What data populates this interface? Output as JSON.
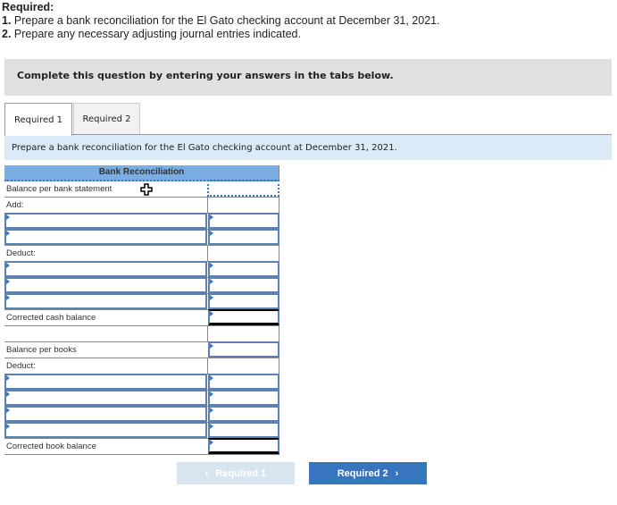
{
  "required": {
    "title": "Required:",
    "items": [
      {
        "num": "1.",
        "text": "Prepare a bank reconciliation for the El Gato checking account at December 31, 2021."
      },
      {
        "num": "2.",
        "text": "Prepare any necessary adjusting journal entries indicated."
      }
    ]
  },
  "instruction": "Complete this question by entering your answers in the tabs below.",
  "tabs": [
    {
      "label": "Required 1",
      "active": true
    },
    {
      "label": "Required 2",
      "active": false
    }
  ],
  "prompt": "Prepare a bank reconciliation for the El Gato checking account at December 31, 2021.",
  "reconciliation": {
    "title": "Bank Reconciliation",
    "rows": [
      {
        "label": "Balance per bank statement",
        "label_value": "",
        "amount_value": ""
      },
      {
        "label": "Add:"
      },
      {
        "label_value": "",
        "amount_value": ""
      },
      {
        "label_value": "",
        "amount_value": ""
      },
      {
        "label": "Deduct:"
      },
      {
        "label_value": "",
        "amount_value": ""
      },
      {
        "label_value": "",
        "amount_value": ""
      },
      {
        "label_value": "",
        "amount_value": ""
      },
      {
        "label": "Corrected cash balance",
        "amount_value": ""
      },
      {
        "label": ""
      },
      {
        "label": "Balance per books",
        "amount_value": ""
      },
      {
        "label": "Deduct:"
      },
      {
        "label_value": "",
        "amount_value": ""
      },
      {
        "label_value": "",
        "amount_value": ""
      },
      {
        "label_value": "",
        "amount_value": ""
      },
      {
        "label_value": "",
        "amount_value": ""
      },
      {
        "label": "Corrected book balance",
        "amount_value": ""
      }
    ]
  },
  "nav": {
    "prev_label": "Required 1",
    "prev_icon": "‹",
    "next_label": "Required 2",
    "next_icon": "›"
  },
  "colors": {
    "header_blue": "#7aaee3",
    "input_border": "#5b82b3",
    "prompt_bg": "#daeaf7",
    "next_button": "#3775be",
    "prev_button_disabled": "#d9e4f1"
  }
}
